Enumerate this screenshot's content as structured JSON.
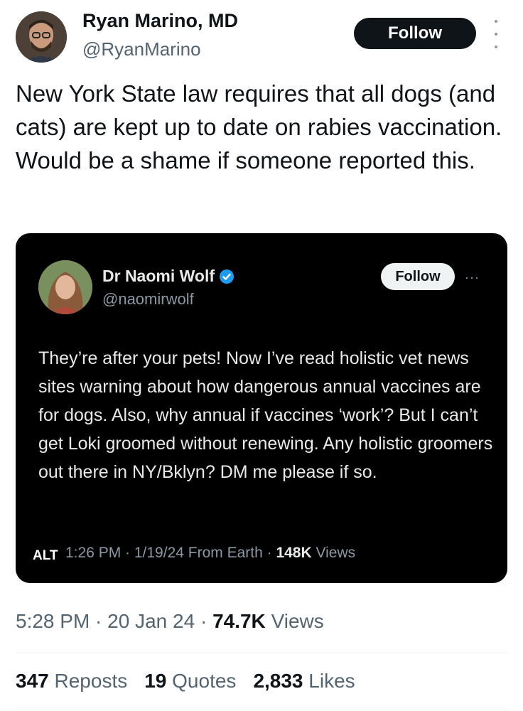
{
  "tweet": {
    "author_name": "Ryan Marino, MD",
    "author_handle": "@RyanMarino",
    "follow_label": "Follow",
    "more_icon": "more-vertical-icon",
    "text": "New York State law requires that all dogs (and cats) are kept up to date on rabies vaccination. Would be a shame if someone reported this.",
    "time": "5:28 PM",
    "date": "20 Jan 24",
    "views_count": "74.7K",
    "views_label": "Views",
    "reposts_count": "347",
    "reposts_label": "Reposts",
    "quotes_count": "19",
    "quotes_label": "Quotes",
    "likes_count": "2,833",
    "likes_label": "Likes"
  },
  "quoted": {
    "author_name": "Dr Naomi Wolf",
    "verified_icon": "verified-badge-icon",
    "author_handle": "@naomirwolf",
    "follow_label": "Follow",
    "more_label": "···",
    "text": "They’re after your pets! Now I’ve read holistic vet news sites warning about how dangerous annual vaccines are for dogs. Also, why annual if vaccines ‘work’? But I can’t get Loki groomed without renewing. Any holistic groomers out there in NY/Bklyn? DM me please if so.",
    "meta_prefix": "1:26 PM · 1/19/24 From Earth · ",
    "views_count": "148K",
    "views_label": " Views",
    "alt_label": "ALT"
  },
  "colors": {
    "text_primary": "#0f1419",
    "text_secondary": "#536471",
    "card_background": "#000000",
    "verified_blue": "#1d9bf0"
  }
}
